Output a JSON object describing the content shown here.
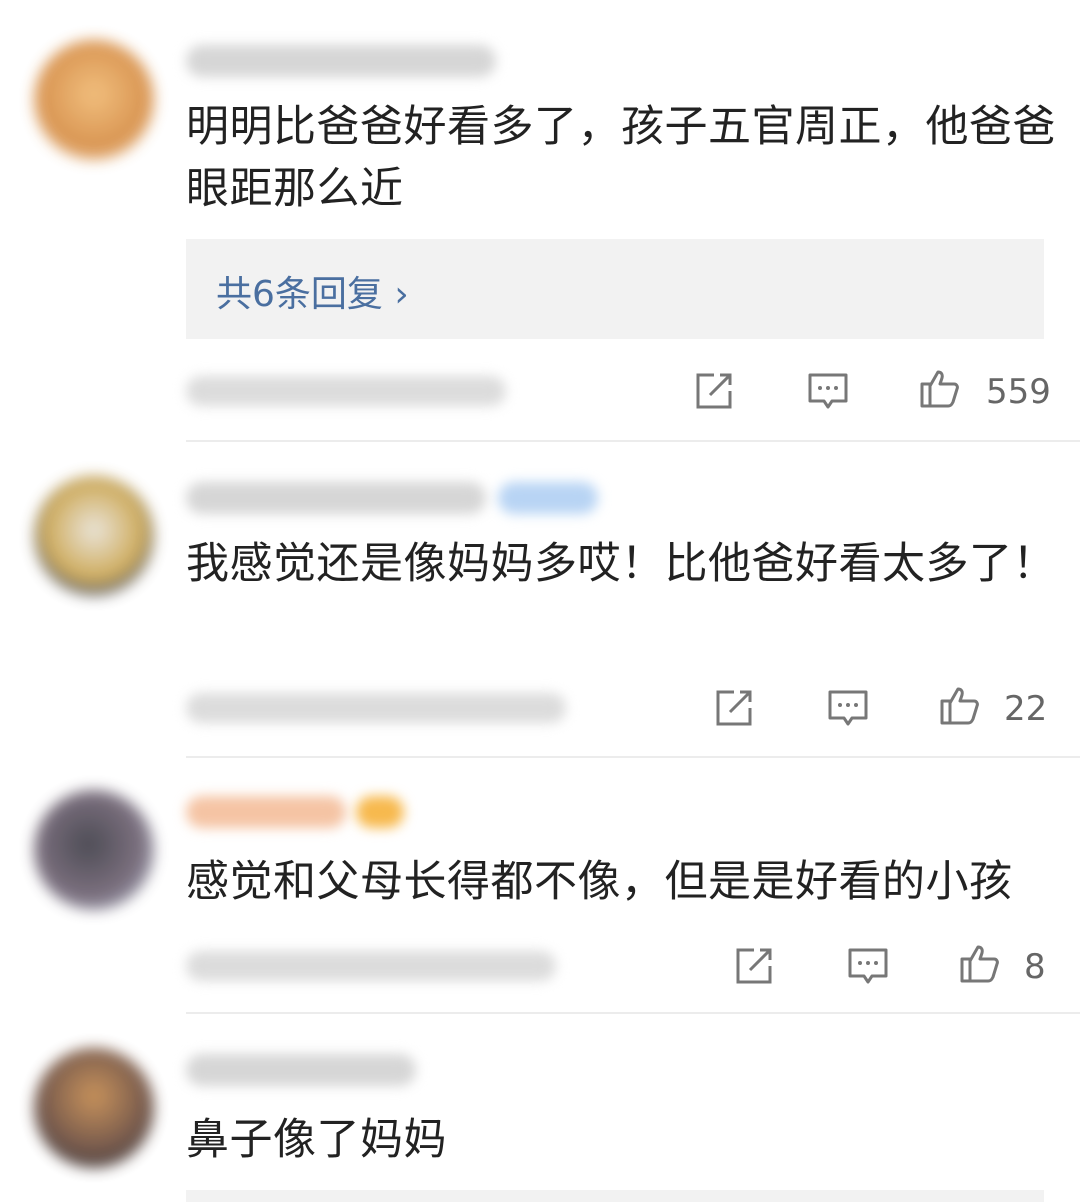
{
  "comments": [
    {
      "text": "明明比爸爸好看多了，孩子五官周正，他爸爸眼距那么近",
      "replies_label": "共6条回复 ›",
      "likes": "559",
      "avatar_color": "#e3a25a"
    },
    {
      "text": "我感觉还是像妈妈多哎！比他爸好看太多了！",
      "likes": "22",
      "avatar_color": "#c9a24a"
    },
    {
      "text": "感觉和父母长得都不像，但是是好看的小孩",
      "likes": "8",
      "avatar_color": "#6d6070"
    },
    {
      "text": "鼻子像了妈妈",
      "avatar_color": "#6b4a3a"
    }
  ],
  "icons": {
    "share": "share-icon",
    "reply": "comment-icon",
    "like": "thumbs-up-icon"
  },
  "colors": {
    "link": "#4a6fa0",
    "reply_bg": "#f2f2f2",
    "divider": "#ececec"
  }
}
